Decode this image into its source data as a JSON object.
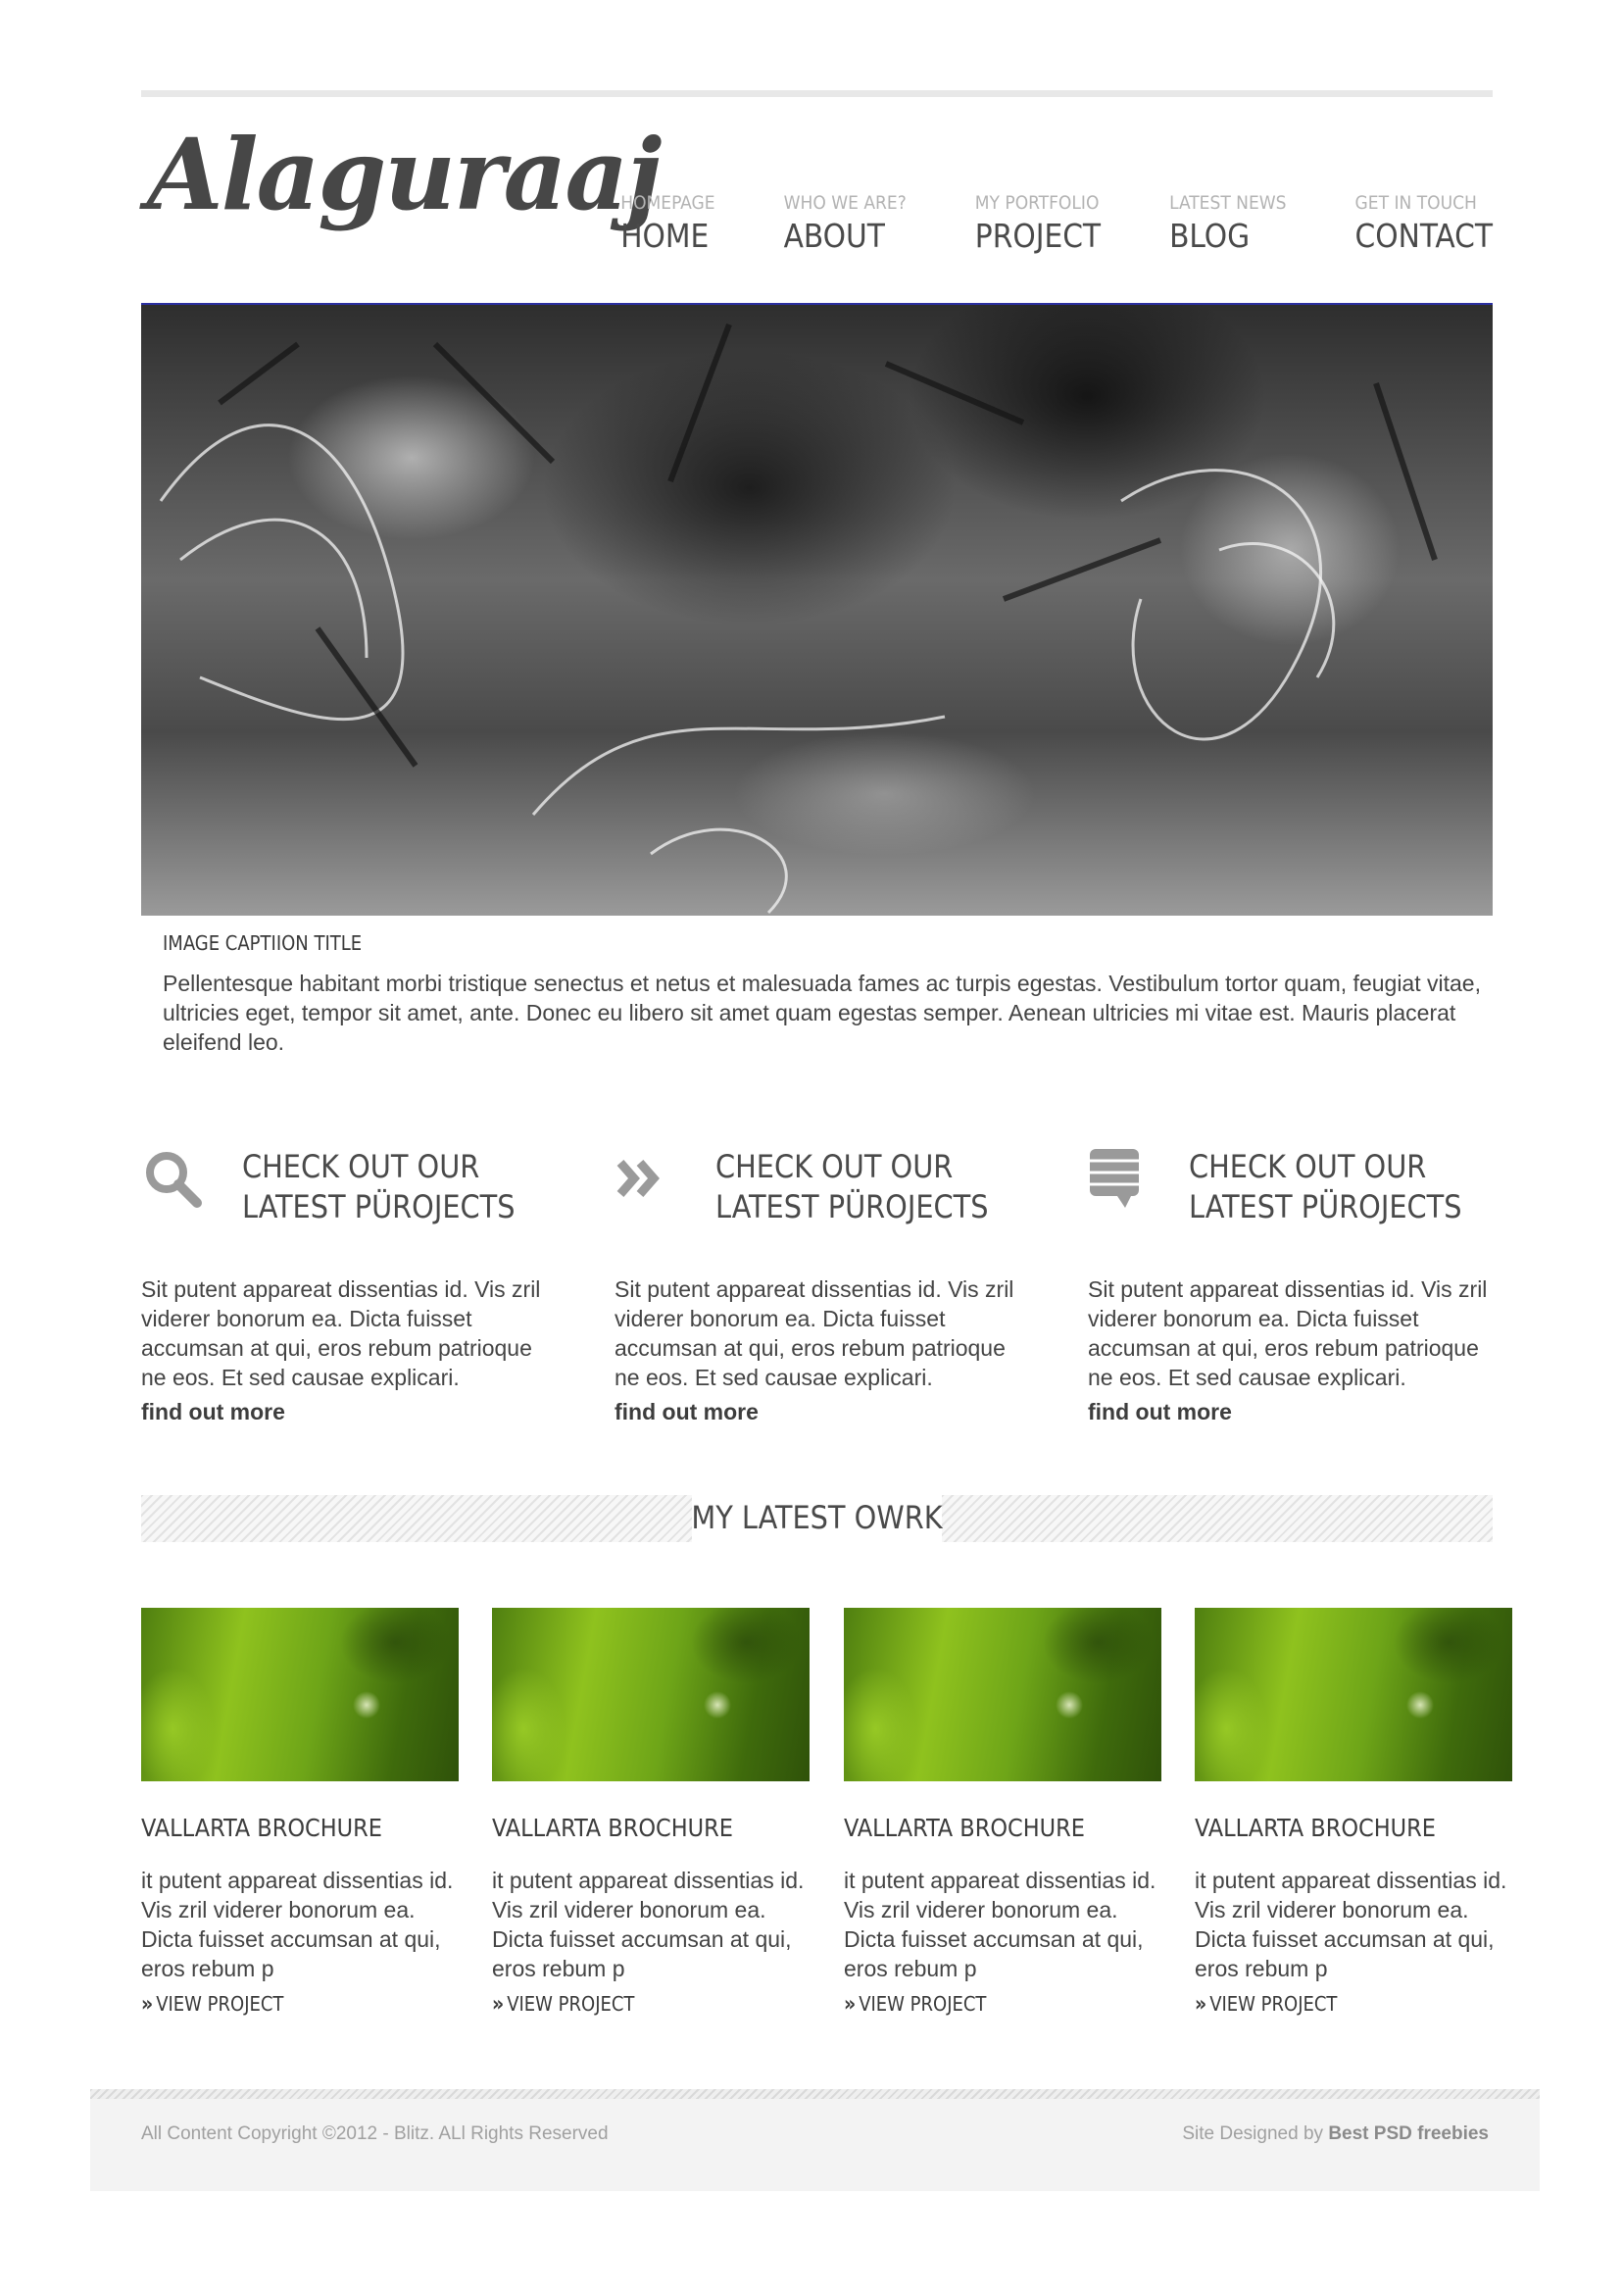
{
  "logo": {
    "text": "Alaguraaj"
  },
  "nav": [
    {
      "sub": "HOMEPAGE",
      "label": "HOME"
    },
    {
      "sub": "WHO WE ARE?",
      "label": "ABOUT"
    },
    {
      "sub": "MY PORTFOLIO",
      "label": "PROJECT"
    },
    {
      "sub": "LATEST NEWS",
      "label": "BLOG"
    },
    {
      "sub": "GET IN TOUCH",
      "label": "CONTACT"
    }
  ],
  "hero": {
    "caption_title": "IMAGE CAPTIION TITLE",
    "caption_text": "Pellentesque habitant morbi tristique senectus et netus et malesuada fames ac turpis egestas. Vestibulum tortor quam, feugiat vitae, ultricies eget, tempor sit amet, ante. Donec eu libero sit amet quam egestas semper. Aenean ultricies mi vitae est. Mauris placerat eleifend leo."
  },
  "features": [
    {
      "icon": "search-icon",
      "title": "CHECK OUT OUR LATEST PÜROJECTS",
      "text": "Sit putent appareat dissentias id. Vis zril viderer bonorum ea. Dicta fuisset accumsan at qui, eros rebum patrioque ne eos. Et sed causae explicari.",
      "link": "find out more"
    },
    {
      "icon": "double-chevron-icon",
      "title": "CHECK OUT OUR LATEST PÜROJECTS",
      "text": "Sit putent appareat dissentias id. Vis zril viderer bonorum ea. Dicta fuisset accumsan at qui, eros rebum patrioque ne eos. Et sed causae explicari.",
      "link": "find out more"
    },
    {
      "icon": "speech-bubble-icon",
      "title": "CHECK OUT OUR LATEST PÜROJECTS",
      "text": "Sit putent appareat dissentias id. Vis zril viderer bonorum ea. Dicta fuisset accumsan at qui, eros rebum patrioque ne eos. Et sed causae explicari.",
      "link": "find out more"
    }
  ],
  "latest_work": {
    "title": "MY LATEST OWRK",
    "items": [
      {
        "title": "VALLARTA BROCHURE",
        "text": "it putent appareat dissentias id. Vis zril viderer bonorum ea. Dicta fuisset accumsan at qui, eros rebum p",
        "link": "VIEW PROJECT"
      },
      {
        "title": "VALLARTA BROCHURE",
        "text": "it putent appareat dissentias id. Vis zril viderer bonorum ea. Dicta fuisset accumsan at qui, eros rebum p",
        "link": "VIEW PROJECT"
      },
      {
        "title": "VALLARTA BROCHURE",
        "text": "it putent appareat dissentias id. Vis zril viderer bonorum ea. Dicta fuisset accumsan at qui, eros rebum p",
        "link": "VIEW PROJECT"
      },
      {
        "title": "VALLARTA BROCHURE",
        "text": "it putent appareat dissentias id. Vis zril viderer bonorum ea. Dicta fuisset accumsan at qui, eros rebum p",
        "link": "VIEW PROJECT"
      }
    ]
  },
  "footer": {
    "copyright": "All Content Copyright ©2012 - Blitz. ALl Rights Reserved",
    "designed_prefix": "Site Designed by",
    "designed_by": "Best PSD freebies"
  },
  "colors": {
    "text": "#444444",
    "heading": "#4a4a4a",
    "muted": "#b3b3b3",
    "rule": "#e8e8e8",
    "footer_bg": "#f3f3f3"
  }
}
